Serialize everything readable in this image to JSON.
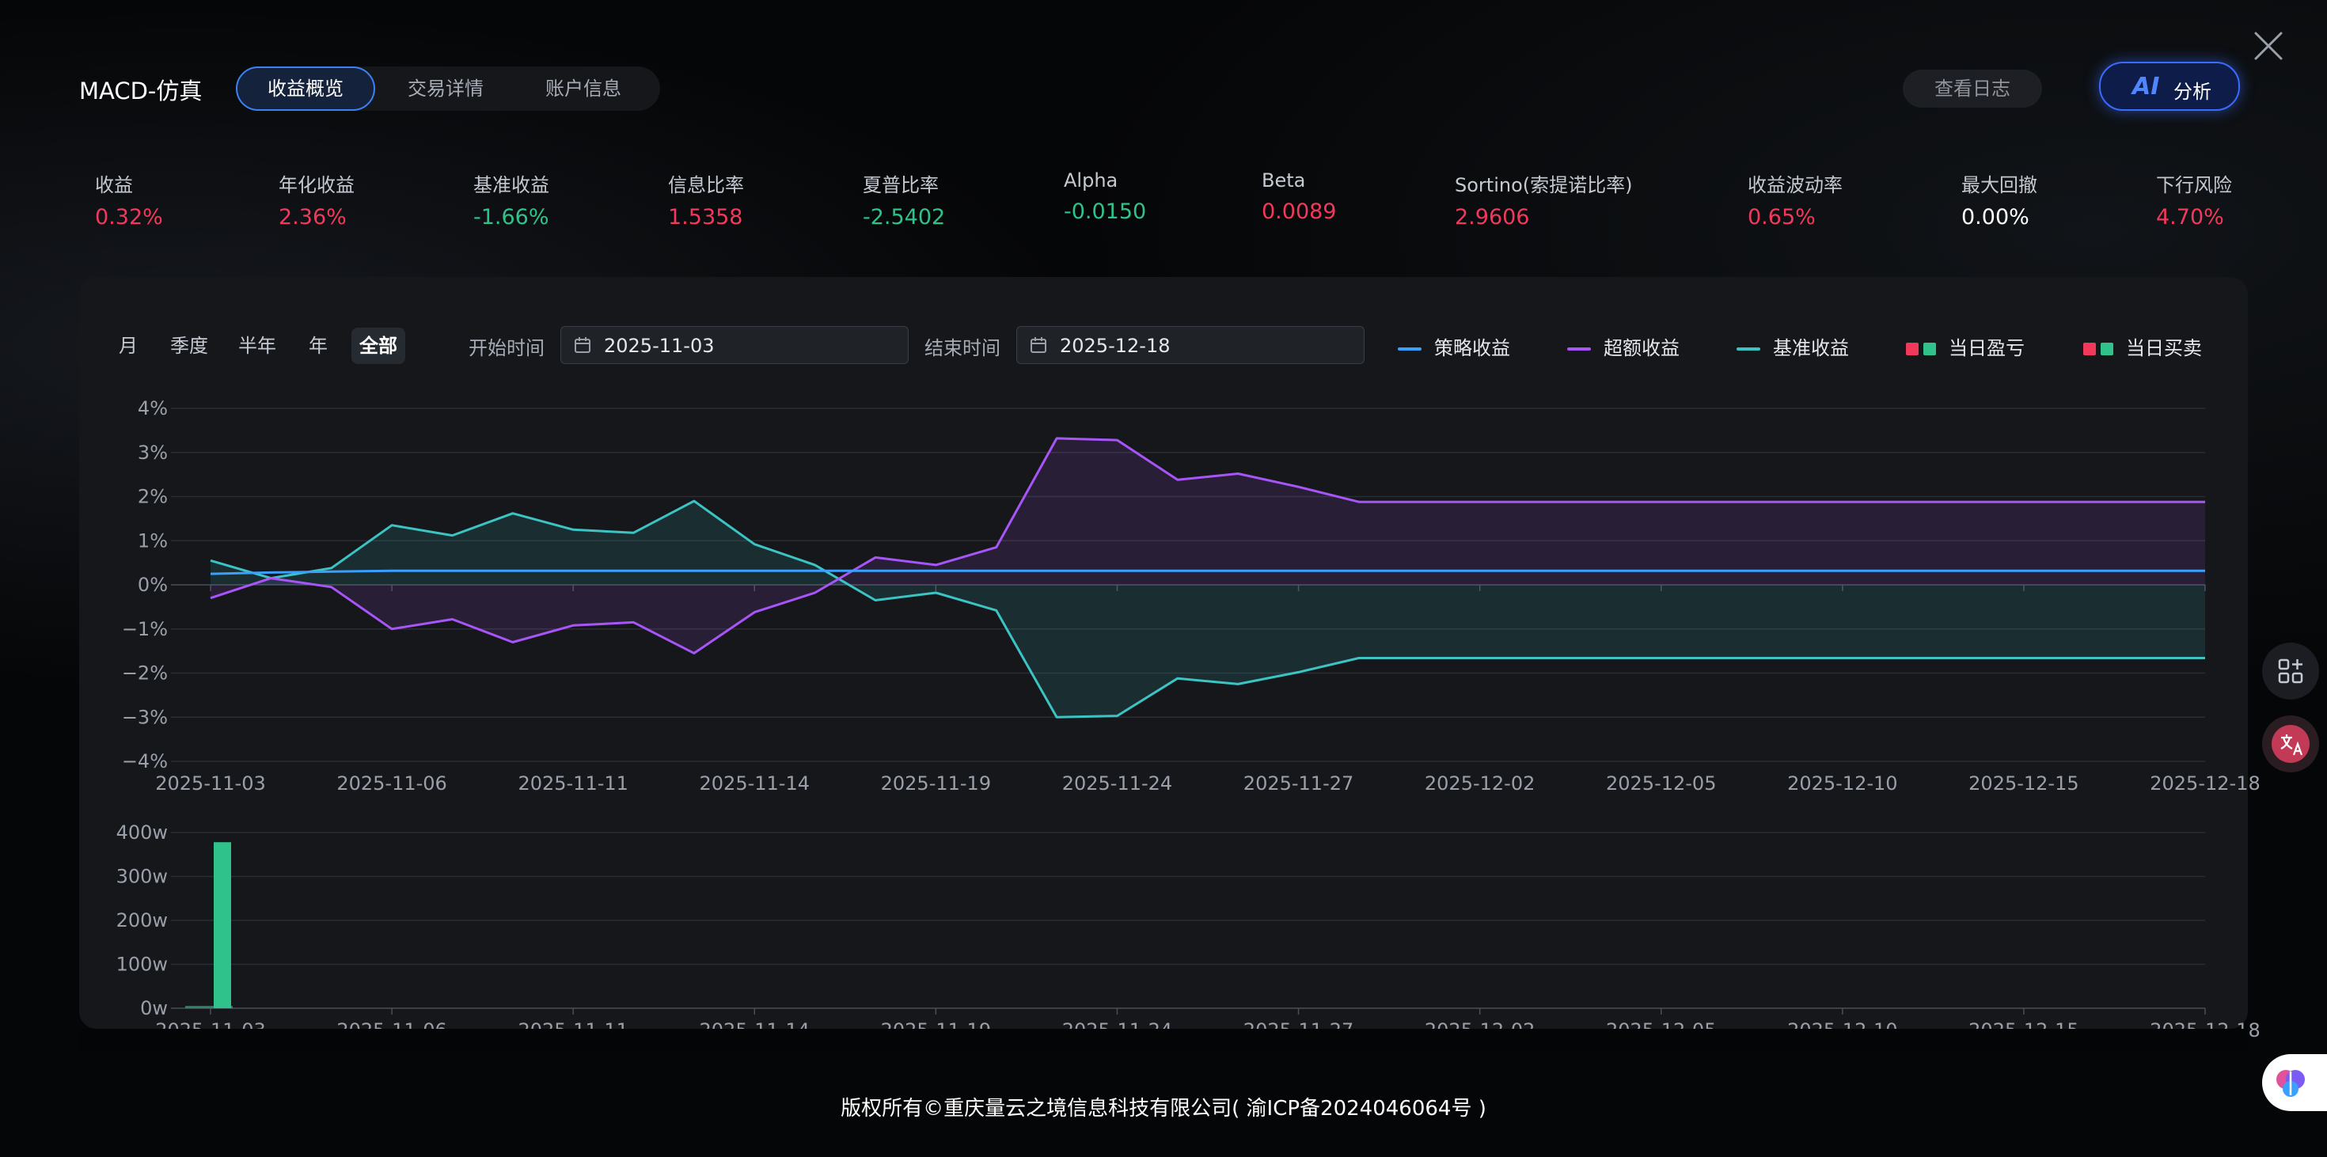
{
  "title": "MACD-仿真",
  "tabs": [
    {
      "label": "收益概览",
      "active": true
    },
    {
      "label": "交易详情",
      "active": false
    },
    {
      "label": "账户信息",
      "active": false
    }
  ],
  "buttons": {
    "log": "查看日志",
    "ai_mark": "AI",
    "ai_label": "分析"
  },
  "colors": {
    "up": "#f2395b",
    "down": "#2fc38b",
    "neutral": "#ffffff",
    "strategy": "#3aa0ff",
    "excess": "#a855f7",
    "benchmark": "#3cc3c3"
  },
  "metrics": [
    {
      "label": "收益",
      "value": "0.32%",
      "tone": "up"
    },
    {
      "label": "年化收益",
      "value": "2.36%",
      "tone": "up"
    },
    {
      "label": "基准收益",
      "value": "-1.66%",
      "tone": "down"
    },
    {
      "label": "信息比率",
      "value": "1.5358",
      "tone": "up"
    },
    {
      "label": "夏普比率",
      "value": "-2.5402",
      "tone": "down"
    },
    {
      "label": "Alpha",
      "value": "-0.0150",
      "tone": "down"
    },
    {
      "label": "Beta",
      "value": "0.0089",
      "tone": "up"
    },
    {
      "label": "Sortino(索提诺比率)",
      "value": "2.9606",
      "tone": "up"
    },
    {
      "label": "收益波动率",
      "value": "0.65%",
      "tone": "up"
    },
    {
      "label": "最大回撤",
      "value": "0.00%",
      "tone": "neutral"
    },
    {
      "label": "下行风险",
      "value": "4.70%",
      "tone": "up"
    }
  ],
  "periods": [
    {
      "label": "月",
      "active": false
    },
    {
      "label": "季度",
      "active": false
    },
    {
      "label": "半年",
      "active": false
    },
    {
      "label": "年",
      "active": false
    },
    {
      "label": "全部",
      "active": true
    }
  ],
  "date_range": {
    "start_label": "开始时间",
    "start": "2025-11-03",
    "end_label": "结束时间",
    "end": "2025-12-18"
  },
  "legend": [
    {
      "label": "策略收益",
      "kind": "line",
      "color": "#3aa0ff"
    },
    {
      "label": "超额收益",
      "kind": "line",
      "color": "#a855f7"
    },
    {
      "label": "基准收益",
      "kind": "line",
      "color": "#3cc3c3"
    },
    {
      "label": "当日盈亏",
      "kind": "squares",
      "colors": [
        "#f2395b",
        "#2fc38b"
      ]
    },
    {
      "label": "当日买卖",
      "kind": "squares",
      "colors": [
        "#f2395b",
        "#2fc38b"
      ]
    }
  ],
  "chart_data": [
    {
      "type": "line",
      "x_ticks": [
        "2025-11-03",
        "2025-11-06",
        "2025-11-11",
        "2025-11-14",
        "2025-11-19",
        "2025-11-24",
        "2025-11-27",
        "2025-12-02",
        "2025-12-05",
        "2025-12-10",
        "2025-12-15",
        "2025-12-18"
      ],
      "y_ticks": [
        "4%",
        "3%",
        "2%",
        "1%",
        "0%",
        "−1%",
        "−2%",
        "−3%",
        "−4%"
      ],
      "ylim": [
        -4,
        4
      ],
      "n_points": 34,
      "series": [
        {
          "name": "策略收益",
          "color": "#3aa0ff",
          "fill": false,
          "values": [
            0.25,
            0.28,
            0.3,
            0.32,
            0.32,
            0.32,
            0.32,
            0.32,
            0.32,
            0.32,
            0.32,
            0.32,
            0.32,
            0.32,
            0.32,
            0.32,
            0.32,
            0.32,
            0.32,
            0.32,
            0.32,
            0.32,
            0.32,
            0.32,
            0.32,
            0.32,
            0.32,
            0.32,
            0.32,
            0.32,
            0.32,
            0.32,
            0.32,
            0.32
          ]
        },
        {
          "name": "超额收益",
          "color": "#a855f7",
          "fill": true,
          "values": [
            -0.3,
            0.15,
            -0.05,
            -1.0,
            -0.78,
            -1.3,
            -0.92,
            -0.85,
            -1.55,
            -0.62,
            -0.18,
            0.62,
            0.45,
            0.85,
            3.32,
            3.28,
            2.38,
            2.52,
            2.22,
            1.88,
            1.88,
            1.88,
            1.88,
            1.88,
            1.88,
            1.88,
            1.88,
            1.88,
            1.88,
            1.88,
            1.88,
            1.88,
            1.88,
            1.88
          ]
        },
        {
          "name": "基准收益",
          "color": "#3cc3c3",
          "fill": true,
          "values": [
            0.55,
            0.15,
            0.38,
            1.35,
            1.12,
            1.62,
            1.25,
            1.18,
            1.9,
            0.92,
            0.45,
            -0.35,
            -0.18,
            -0.58,
            -3.0,
            -2.97,
            -2.12,
            -2.25,
            -1.98,
            -1.66,
            -1.66,
            -1.66,
            -1.66,
            -1.66,
            -1.66,
            -1.66,
            -1.66,
            -1.66,
            -1.66,
            -1.66,
            -1.66,
            -1.66,
            -1.66,
            -1.66
          ]
        }
      ]
    },
    {
      "type": "bar",
      "x_ticks": [
        "2025-11-03",
        "2025-11-06",
        "2025-11-11",
        "2025-11-14",
        "2025-11-19",
        "2025-11-24",
        "2025-11-27",
        "2025-12-02",
        "2025-12-05",
        "2025-12-10",
        "2025-12-15",
        "2025-12-18"
      ],
      "y_ticks": [
        "400w",
        "300w",
        "200w",
        "100w",
        "0w"
      ],
      "ylim": [
        0,
        400
      ],
      "bars": [
        {
          "index": 0,
          "value": 378,
          "color": "#2fc38b"
        }
      ]
    }
  ],
  "footer": "版权所有©重庆量云之境信息科技有限公司( 渝ICP备2024046064号 )"
}
